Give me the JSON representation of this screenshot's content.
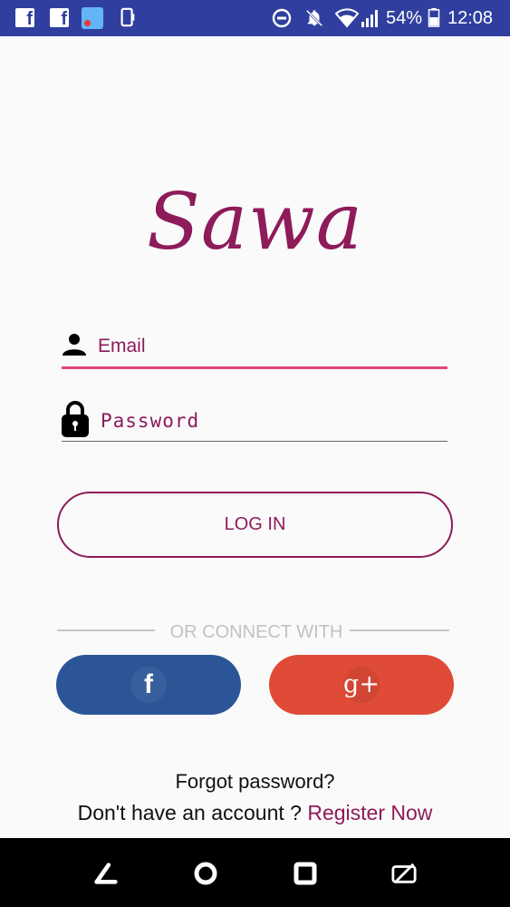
{
  "status_bar": {
    "notifications": [
      {
        "icon": "facebook-notification-icon",
        "glyph": "f"
      },
      {
        "icon": "facebook-notification-icon",
        "glyph": "f"
      },
      {
        "icon": "app-notification-icon"
      },
      {
        "icon": "phone-notification-icon"
      }
    ],
    "battery": "54%",
    "time": "12:08",
    "icons": [
      "do-not-disturb-icon",
      "notifications-off-icon",
      "wifi-icon",
      "signal-icon",
      "battery-icon"
    ]
  },
  "logo": {
    "text": "Sawa",
    "color": "#8e1b5a"
  },
  "form": {
    "email": {
      "placeholder": "Email",
      "value": ""
    },
    "password": {
      "placeholder": "Password",
      "value": ""
    },
    "login_label": "LOG IN"
  },
  "divider_label": "OR CONNECT WITH",
  "social": {
    "facebook": {
      "glyph": "f",
      "color": "#2b5597"
    },
    "google": {
      "glyph": "g+",
      "color": "#df4b37"
    }
  },
  "footer": {
    "forgot_password": "Forgot password?",
    "register_prompt": "Don't have an account ? ",
    "register_link": "Register Now"
  },
  "nav_bar": [
    "back-icon",
    "home-icon",
    "recents-icon",
    "rotate-lock-icon"
  ],
  "colors": {
    "status_bar": "#303f9f",
    "accent": "#8e1b5a",
    "focus_underline": "#e0457b",
    "nav_bar": "#000000"
  }
}
